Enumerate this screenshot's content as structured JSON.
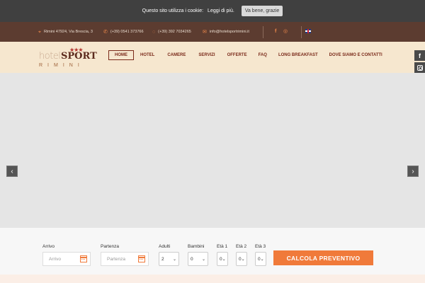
{
  "cookie": {
    "text": "Questo sito utilizza i cookie:",
    "link": "Leggi di più.",
    "button": "Va bene, grazie"
  },
  "contacts": {
    "address": "Rimini 47924, Via Brescia, 3",
    "phone": "(+39) 0541 373766",
    "whatsapp": "(+39) 392 7034265",
    "email": "info@hotelsportrimini.it"
  },
  "social": {
    "facebook_icon": "facebook-icon",
    "instagram_icon": "instagram-icon",
    "language_icon": "uk-flag-icon"
  },
  "logo": {
    "stars": "★★★",
    "word1": "hotel",
    "word2": "SPORT",
    "city": "RIMINI"
  },
  "nav": {
    "items": [
      "HOME",
      "HOTEL",
      "CAMERE",
      "SERVIZI",
      "OFFERTE",
      "FAQ",
      "LONG BREAKFAST",
      "DOVE SIAMO E CONTATTI"
    ],
    "active": "HOME"
  },
  "slider": {
    "prev": "‹",
    "next": "›"
  },
  "booking": {
    "arrival_label": "Arrivo",
    "arrival_placeholder": "Arrivo",
    "departure_label": "Partenza",
    "departure_placeholder": "Partenza",
    "adults_label": "Adulti",
    "adults_value": "2",
    "children_label": "Bambini",
    "children_value": "0",
    "age1_label": "Età 1",
    "age1_value": "0",
    "age2_label": "Età 2",
    "age2_value": "0",
    "age3_label": "Età 3",
    "age3_value": "0",
    "submit": "CALCOLA PREVENTIVO"
  },
  "colors": {
    "topbar": "#5c3c30",
    "header": "#f6e7cf",
    "accent": "#f07a3a",
    "nav_text": "#7a2a1a"
  }
}
